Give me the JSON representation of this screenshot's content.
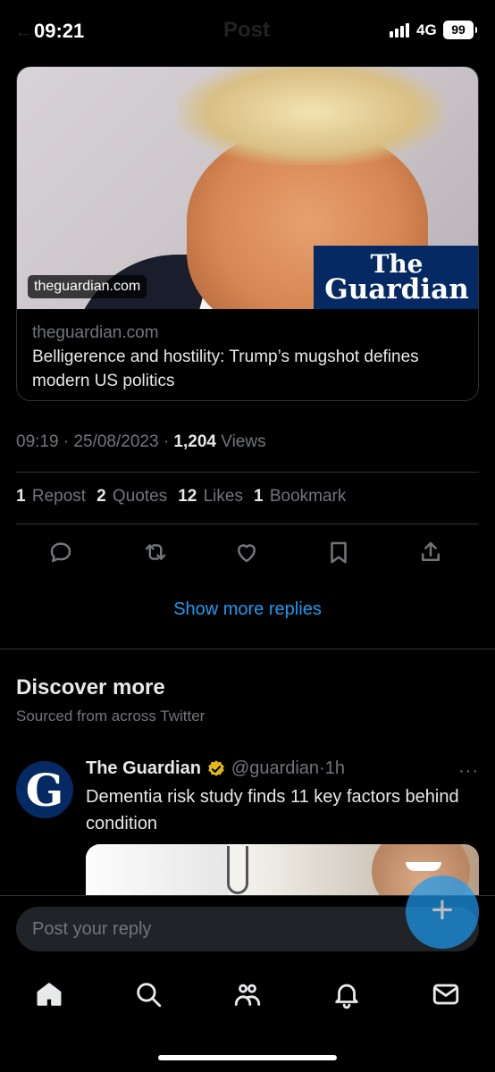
{
  "status_bar": {
    "time": "09:21",
    "network": "4G",
    "battery": "99",
    "ghost_title": "Post",
    "ghost_back": "←"
  },
  "link_card": {
    "image_source_label": "theguardian.com",
    "logo_line1": "The",
    "logo_line2": "Guardian",
    "domain": "theguardian.com",
    "title": "Belligerence and hostility: Trump’s mugshot defines modern US politics"
  },
  "meta": {
    "time": "09:19",
    "sep1": "·",
    "date": "25/08/2023",
    "sep2": "·",
    "views_count": "1,204",
    "views_label": "Views"
  },
  "stats": {
    "reposts_count": "1",
    "reposts_label": "Repost",
    "quotes_count": "2",
    "quotes_label": "Quotes",
    "likes_count": "12",
    "likes_label": "Likes",
    "bookmarks_count": "1",
    "bookmarks_label": "Bookmark"
  },
  "actions": {
    "icons": [
      "reply-icon",
      "repost-icon",
      "like-icon",
      "bookmark-icon",
      "share-icon"
    ]
  },
  "show_more_label": "Show more replies",
  "discover": {
    "title": "Discover more",
    "subtitle": "Sourced from across Twitter"
  },
  "tweet": {
    "avatar_letter": "G",
    "name": "The Guardian",
    "handle": "@guardian",
    "dot": "·",
    "time": "1h",
    "more": "···",
    "text": "Dementia risk study finds 11 key factors behind condition"
  },
  "fab_label": "+",
  "reply": {
    "placeholder": "Post your reply"
  },
  "colors": {
    "accent": "#1d9bf0",
    "background": "#000000",
    "text_primary": "#e7e9ea",
    "text_secondary": "#71767b",
    "divider": "#2f3336",
    "guardian_blue": "#052962",
    "verified_gold": "#e2b719"
  }
}
